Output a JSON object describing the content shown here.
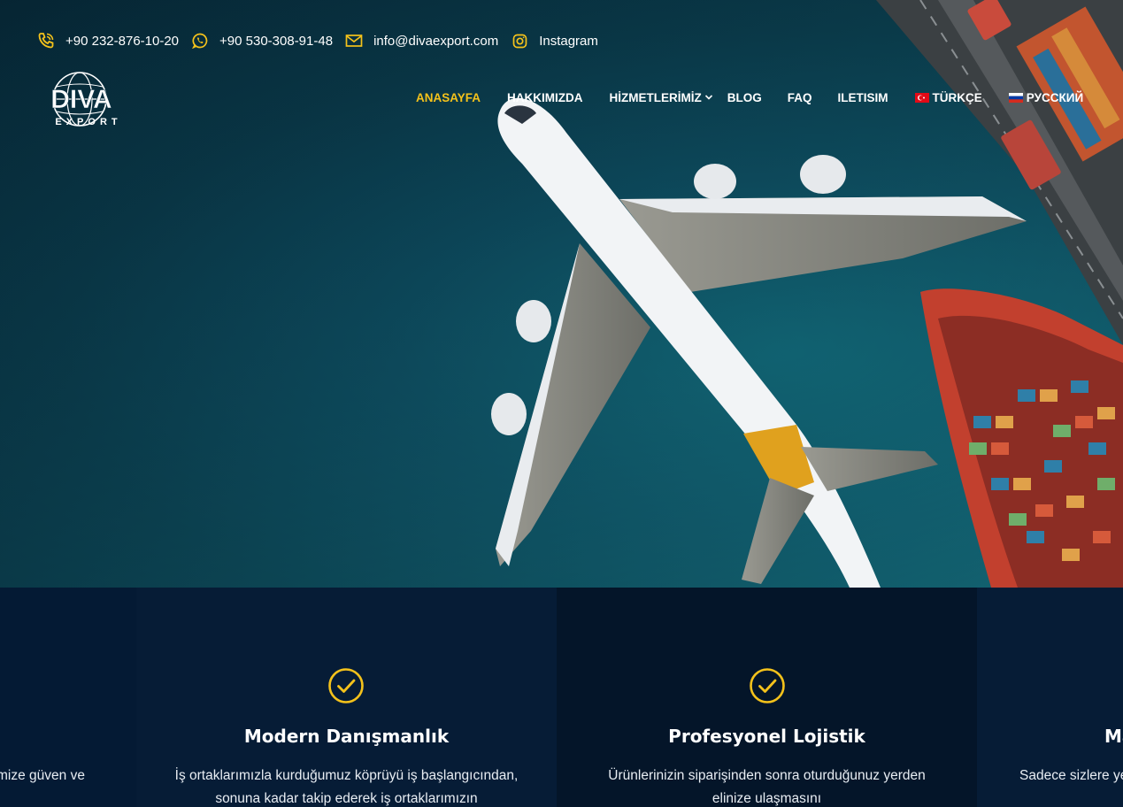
{
  "contacts": [
    {
      "icon": "phone-icon",
      "text": "+90 232-876-10-20"
    },
    {
      "icon": "whatsapp-icon",
      "text": "+90 530-308-91-48"
    },
    {
      "icon": "mail-icon",
      "text": "info@divaexport.com"
    },
    {
      "icon": "instagram-icon",
      "text": "Instagram"
    }
  ],
  "logo": {
    "line1": "DIVA",
    "line2": "EXPORT"
  },
  "nav": {
    "home": "ANASAYFA",
    "about": "HAKKIMIZDA",
    "services": "HİZMETLERİMİZ",
    "blog": "BLOG",
    "faq": "FAQ",
    "contact": "ILETISIM",
    "lang_tr": "TÜRKÇE",
    "lang_ru": "РУССКИЙ"
  },
  "features": {
    "left_partial": {
      "text": "mize güven ve"
    },
    "modern": {
      "title": "Modern Danışmanlık",
      "text1": "İş ortaklarımızla kurduğumuz köprüyü iş başlangıcından,",
      "text2": "sonuna kadar takip ederek iş ortaklarımızın"
    },
    "logistics": {
      "title": "Profesyonel Lojistik",
      "text1": "Ürünlerinizin siparişinden sonra oturduğunuz yerden",
      "text2": "elinize ulaşmasını"
    },
    "right_partial": {
      "title": "Ma",
      "text": "Sadece sizlere ye"
    }
  },
  "colors": {
    "accent": "#f4c21b",
    "section_bg": "#061c36",
    "hero_sea": "#0b3f52"
  }
}
